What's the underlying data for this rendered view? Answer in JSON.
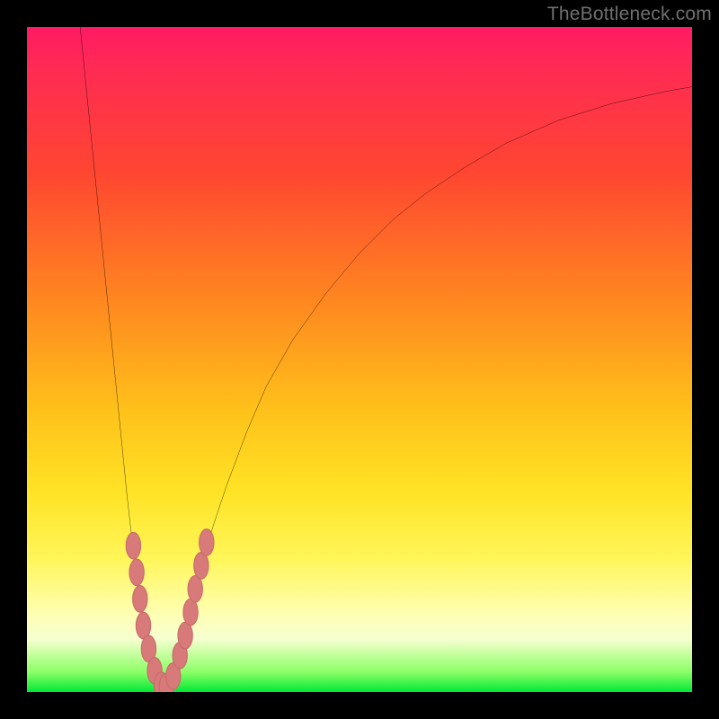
{
  "watermark": "TheBottleneck.com",
  "colors": {
    "frame": "#000000",
    "curve": "#000000",
    "marker_fill": "#d97a7a",
    "marker_stroke": "#c86a6a",
    "gradient_top": "#ff1a63",
    "gradient_bottom": "#00e835"
  },
  "chart_data": {
    "type": "line",
    "title": "",
    "xlabel": "",
    "ylabel": "",
    "xlim": [
      0,
      100
    ],
    "ylim": [
      0,
      100
    ],
    "series": [
      {
        "name": "bottleneck-curve",
        "x": [
          8,
          9,
          10,
          11,
          12,
          13,
          14,
          15,
          16,
          17,
          18,
          19,
          20,
          21,
          22,
          23,
          24,
          25,
          26,
          28,
          30,
          33,
          36,
          40,
          45,
          50,
          55,
          60,
          66,
          72,
          80,
          88,
          96,
          100
        ],
        "y": [
          100,
          90,
          80,
          70,
          60,
          50,
          40,
          30,
          21,
          14,
          8,
          3.5,
          0.8,
          0.7,
          2.5,
          6,
          10,
          14,
          18,
          25,
          31,
          39,
          46,
          53,
          60,
          66,
          71,
          75,
          79,
          82.5,
          86,
          88.5,
          90.3,
          91
        ]
      }
    ],
    "markers": {
      "name": "sample-points",
      "points": [
        {
          "x": 16.0,
          "y": 22
        },
        {
          "x": 16.5,
          "y": 18
        },
        {
          "x": 17.0,
          "y": 14
        },
        {
          "x": 17.5,
          "y": 10
        },
        {
          "x": 18.3,
          "y": 6.5
        },
        {
          "x": 19.2,
          "y": 3.2
        },
        {
          "x": 20.2,
          "y": 1.0
        },
        {
          "x": 21.0,
          "y": 0.8
        },
        {
          "x": 22.0,
          "y": 2.4
        },
        {
          "x": 23.0,
          "y": 5.5
        },
        {
          "x": 23.8,
          "y": 8.5
        },
        {
          "x": 24.6,
          "y": 12.0
        },
        {
          "x": 25.3,
          "y": 15.5
        },
        {
          "x": 26.2,
          "y": 19.0
        },
        {
          "x": 27.0,
          "y": 22.5
        }
      ],
      "rx": 1.1,
      "ry": 2.0
    }
  }
}
